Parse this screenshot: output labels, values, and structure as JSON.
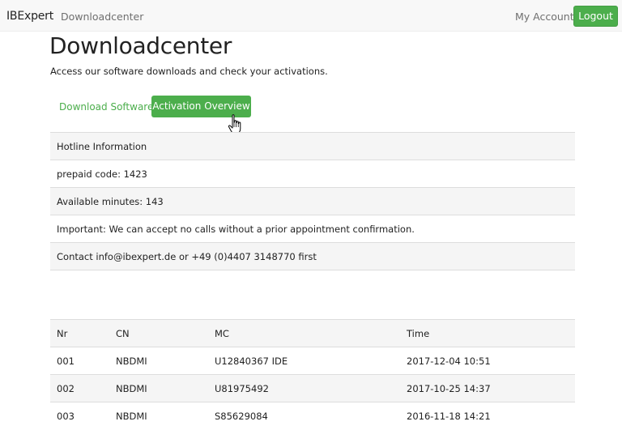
{
  "navbar": {
    "brand": "IBExpert",
    "link": "Downloadcenter",
    "account": "My Account",
    "logout": "Logout",
    "accent_color": "#4cae4c"
  },
  "header": {
    "title": "Downloadcenter",
    "subtitle": "Access our software downloads and check your activations."
  },
  "tabs": {
    "download": "Download Software",
    "activation": "Activation Overview"
  },
  "hotline": {
    "rows": [
      "Hotline Information",
      "prepaid code: 1423",
      "Available minutes: 143",
      "Important: We can accept no calls without a prior appointment confirmation.",
      "Contact info@ibexpert.de or +49 (0)4407 3148770 first"
    ]
  },
  "activations": {
    "columns": [
      "Nr",
      "CN",
      "MC",
      "Time"
    ],
    "rows": [
      [
        "001",
        "NBDMI",
        "U12840367 IDE",
        "2017-12-04 10:51"
      ],
      [
        "002",
        "NBDMI",
        "U81975492",
        "2017-10-25 14:37"
      ],
      [
        "003",
        "NBDMI",
        "S85629084",
        "2016-11-18 14:21"
      ]
    ]
  },
  "icons": {
    "cursor": "hand-pointer-icon"
  }
}
